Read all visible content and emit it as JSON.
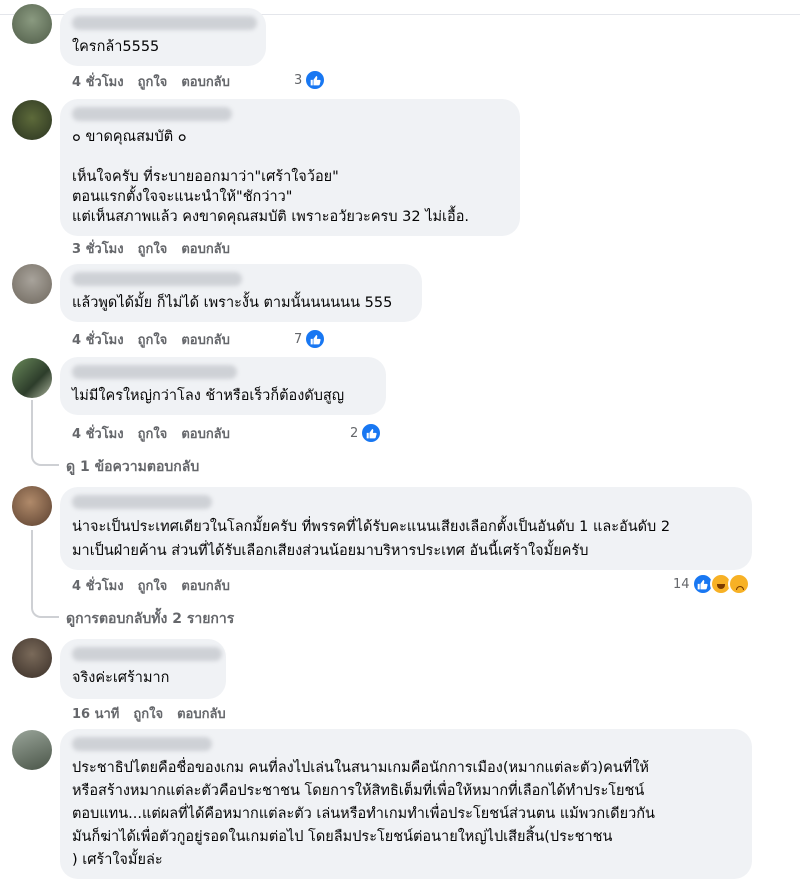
{
  "comments": [
    {
      "text": "ใครกล้า5555",
      "time": "4 ชั่วโมง",
      "like": "ถูกใจ",
      "reply": "ตอบกลับ",
      "reactions": "3"
    },
    {
      "text": "๐ ขาดคุณสมบัติ ๐\n\nเห็นใจครับ ที่ระบายออกมาว่า\"เศร้าใจว้อย\"\nตอนแรกตั้งใจจะแนะนำให้\"ชักว่าว\"\nแต่เห็นสภาพแล้ว คงขาดคุณสมบัติ เพราะอวัยวะครบ 32 ไม่เอื้อ.",
      "time": "3 ชั่วโมง",
      "like": "ถูกใจ",
      "reply": "ตอบกลับ"
    },
    {
      "text": "แล้วพูดได้มั้ย ก็ไม่ได้ เพราะงั้น ตามนั้นนนนนน 555",
      "time": "4 ชั่วโมง",
      "like": "ถูกใจ",
      "reply": "ตอบกลับ",
      "reactions": "7"
    },
    {
      "text": "ไม่มีใครใหญ่กว่าโลง ช้าหรือเร็วก็ต้องดับสูญ",
      "time": "4 ชั่วโมง",
      "like": "ถูกใจ",
      "reply": "ตอบกลับ",
      "reactions": "2",
      "view_replies": "ดู 1 ข้อความตอบกลับ"
    },
    {
      "text": "น่าจะเป็นประเทศเดียวในโลกมั้ยครับ ที่พรรคที่ได้รับคะแนนเสียงเลือกตั้งเป็นอันดับ 1 และอันดับ 2\nมาเป็นฝ่ายค้าน ส่วนที่ได้รับเลือกเสียงส่วนน้อยมาบริหารประเทศ อันนี้เศร้าใจมั้ยครับ",
      "time": "4 ชั่วโมง",
      "like": "ถูกใจ",
      "reply": "ตอบกลับ",
      "reactions": "14",
      "view_replies": "ดูการตอบกลับทั้ง 2 รายการ"
    },
    {
      "text": "จริงค่ะเศร้ามาก",
      "time": "16 นาที",
      "like": "ถูกใจ",
      "reply": "ตอบกลับ"
    },
    {
      "text": "ประชาธิปไตยคือชื่อของเกม คนที่ลงไปเล่นในสนามเกมคือนักการเมือง(หมากแต่ละตัว)คนที่ให้\nหรือสร้างหมากแต่ละตัวคือประชาชน โดยการให้สิทธิเต็มที่เพื่อให้หมากที่เลือกได้ทำประโยชน์\nตอบแทน...แต่ผลที่ได้คือหมากแต่ละตัว เล่นหรือทำเกมทำเพื่อประโยชน์ส่วนตน แม้พวกเดียวกัน\nมันก็ฆ่าได้เพื่อตัวกูอยู่รอดในเกมต่อไป โดยลืมประโยชน์ต่อนายใหญ่ไปเสียสิ้น(ประชาชน\n) เศร้าใจมั้ยล่ะ"
    }
  ],
  "colors": {
    "like_blue": "#1877f2",
    "bubble_bg": "#f0f2f5",
    "meta_gray": "#65676b"
  }
}
